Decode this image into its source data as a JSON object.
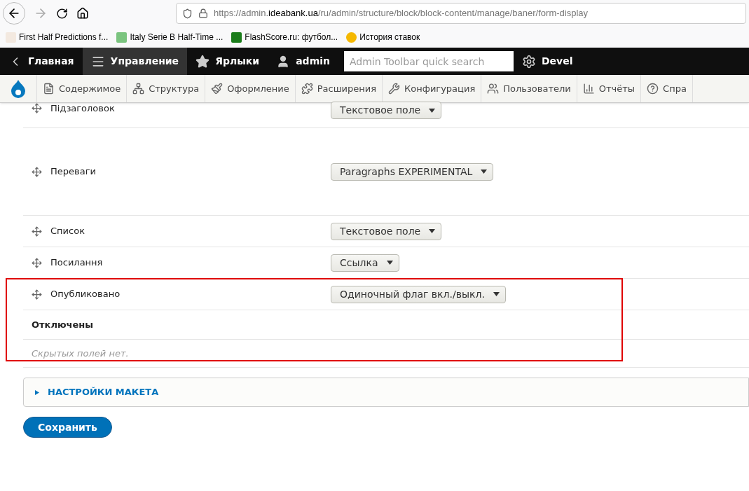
{
  "browser": {
    "url_prefix": "https://admin.",
    "url_domain": "ideabank.ua",
    "url_path": "/ru/admin/structure/block/block-content/manage/baner/form-display"
  },
  "bookmarks": [
    {
      "label": "First Half Predictions f..."
    },
    {
      "label": "Italy Serie B Half-Time ..."
    },
    {
      "label": "FlashScore.ru: футбол..."
    },
    {
      "label": "История ставок"
    }
  ],
  "toolbar": {
    "items": [
      {
        "label": "Главная",
        "selected": false
      },
      {
        "label": "Управление",
        "selected": true
      },
      {
        "label": "Ярлыки",
        "selected": false
      },
      {
        "label": "admin",
        "selected": false
      }
    ],
    "search": {
      "placeholder": "Admin Toolbar quick search"
    },
    "devel": "Devel"
  },
  "tray": [
    {
      "label": "Содержимое"
    },
    {
      "label": "Структура"
    },
    {
      "label": "Оформление"
    },
    {
      "label": "Расширения"
    },
    {
      "label": "Конфигурация"
    },
    {
      "label": "Пользователи"
    },
    {
      "label": "Отчёты"
    },
    {
      "label": "Спра"
    }
  ],
  "fields": [
    {
      "label": "Підзаголовок",
      "widget": "Текстовое поле",
      "tall": false
    },
    {
      "label": "Переваги",
      "widget": "Paragraphs EXPERIMENTAL",
      "tall": true
    },
    {
      "label": "Список",
      "widget": "Текстовое поле",
      "tall": false
    },
    {
      "label": "Посилання",
      "widget": "Ссылка",
      "tall": false
    },
    {
      "label": "Опубликовано",
      "widget": "Одиночный флаг вкл./выкл.",
      "tall": false
    }
  ],
  "disabled_section": {
    "title": "Отключены",
    "empty": "Скрытых полей нет."
  },
  "details": {
    "summary": "НАСТРОЙКИ МАКЕТА",
    "expanded": false
  },
  "save": "Сохранить"
}
